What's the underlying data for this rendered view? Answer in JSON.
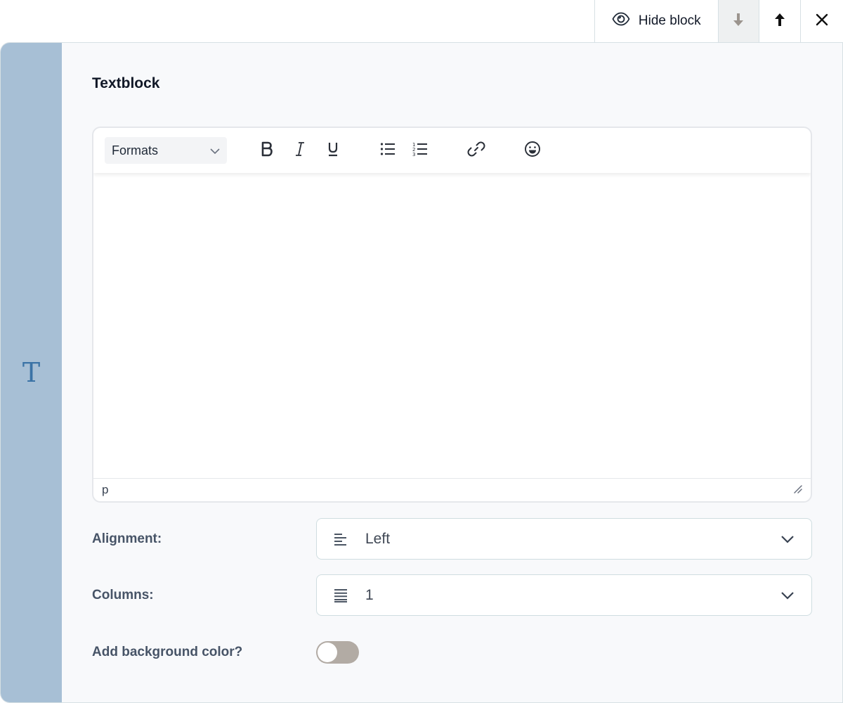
{
  "actions": {
    "hide_label": "Hide block",
    "down_icon": "arrow-down-icon",
    "up_icon": "arrow-up-icon",
    "close_icon": "close-icon"
  },
  "block": {
    "type_glyph": "T",
    "title": "Textblock"
  },
  "editor": {
    "formats_label": "Formats",
    "toolbar_icons": [
      "bold-icon",
      "italic-icon",
      "underline-icon",
      "bullet-list-icon",
      "numbered-list-icon",
      "link-icon",
      "emoji-icon"
    ],
    "status_path": "p",
    "content": ""
  },
  "fields": {
    "alignment": {
      "label": "Alignment:",
      "value": "Left"
    },
    "columns": {
      "label": "Columns:",
      "value": "1"
    },
    "background": {
      "label": "Add background color?",
      "enabled": false
    }
  },
  "colors": {
    "rail": "#a7bfd5",
    "rail_glyph": "#3b73a6",
    "toggle_off": "#b2aba4"
  }
}
